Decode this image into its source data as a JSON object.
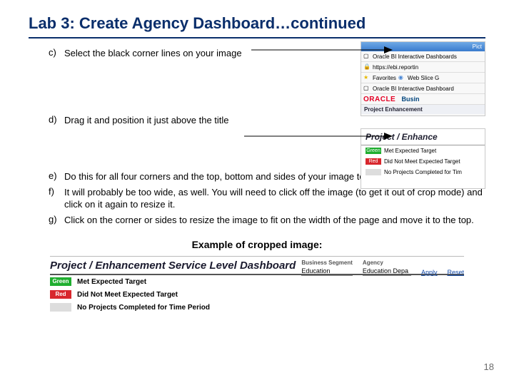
{
  "title": "Lab 3: Create Agency Dashboard…continued",
  "steps": {
    "c": {
      "letter": "c)",
      "text": "Select the black corner lines on your image"
    },
    "d": {
      "letter": "d)",
      "text": "Drag it and position it just above the title"
    },
    "e": {
      "letter": "e)",
      "text": "Do this for all four corners and the top, bottom and sides of your image to crop it."
    },
    "f": {
      "letter": "f)",
      "text": "It will probably be too wide, as well. You will need to click off the image (to get it out of crop mode) and click on it again to resize it."
    },
    "g": {
      "letter": "g)",
      "text": "Click on the corner or sides to resize the image to fit on the width of the page and move it to the top."
    }
  },
  "example_label": "Example of cropped image:",
  "thumb_c": {
    "topbar": "Pict",
    "row1": "Oracle BI Interactive Dashboards",
    "row2": "https://ebi.reportin",
    "fav": "Favorites",
    "slice": "Web Slice G",
    "row4": "Oracle BI Interactive Dashboard",
    "oracle": "ORACLE",
    "busi": "Busin",
    "proj": "Project Enhancement"
  },
  "thumb_d": {
    "header": "Project / Enhance",
    "green_lbl": "Green",
    "green_txt": "Met Expected Target",
    "red_lbl": "Red",
    "red_txt": "Did Not Meet Expected Target",
    "gray_txt": "No Projects Completed for Tim"
  },
  "example": {
    "heading": "Project / Enhancement Service Level Dashboard",
    "green_lbl": "Green",
    "green_txt": "Met Expected Target",
    "red_lbl": "Red",
    "red_txt": "Did Not Meet Expected Target",
    "gray_txt": "No Projects Completed for Time Period",
    "col1_label": "Business Segment",
    "col1_val": "Education",
    "col2_label": "Agency",
    "col2_val": "Education Depa",
    "apply": "Apply",
    "reset": "Reset"
  },
  "page_number": "18"
}
